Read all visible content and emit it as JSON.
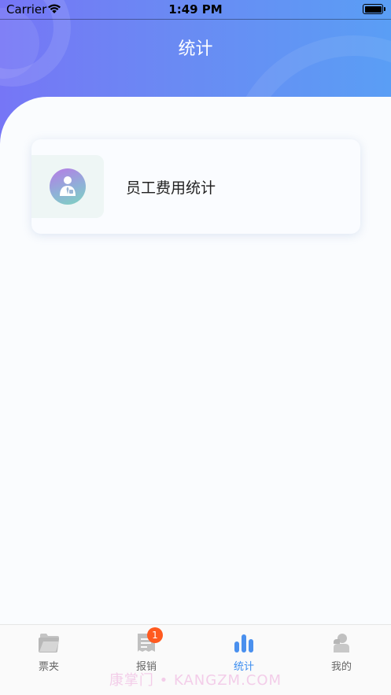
{
  "status_bar": {
    "carrier": "Carrier",
    "time": "1:49 PM"
  },
  "header": {
    "title": "统计"
  },
  "cards": [
    {
      "label": "员工费用统计",
      "icon": "employee-icon"
    }
  ],
  "tabbar": {
    "tabs": [
      {
        "label": "票夹",
        "icon": "folder-icon",
        "active": false
      },
      {
        "label": "报销",
        "icon": "receipt-icon",
        "badge": "1",
        "active": false
      },
      {
        "label": "统计",
        "icon": "bar-chart-icon",
        "active": true
      },
      {
        "label": "我的",
        "icon": "user-icon",
        "active": false
      }
    ]
  },
  "watermark": "康掌门 • KANGZM.COM",
  "colors": {
    "accent": "#3a8cf0",
    "badge": "#ff5a1f",
    "header_start": "#7676f6",
    "header_end": "#5a9ef5"
  }
}
